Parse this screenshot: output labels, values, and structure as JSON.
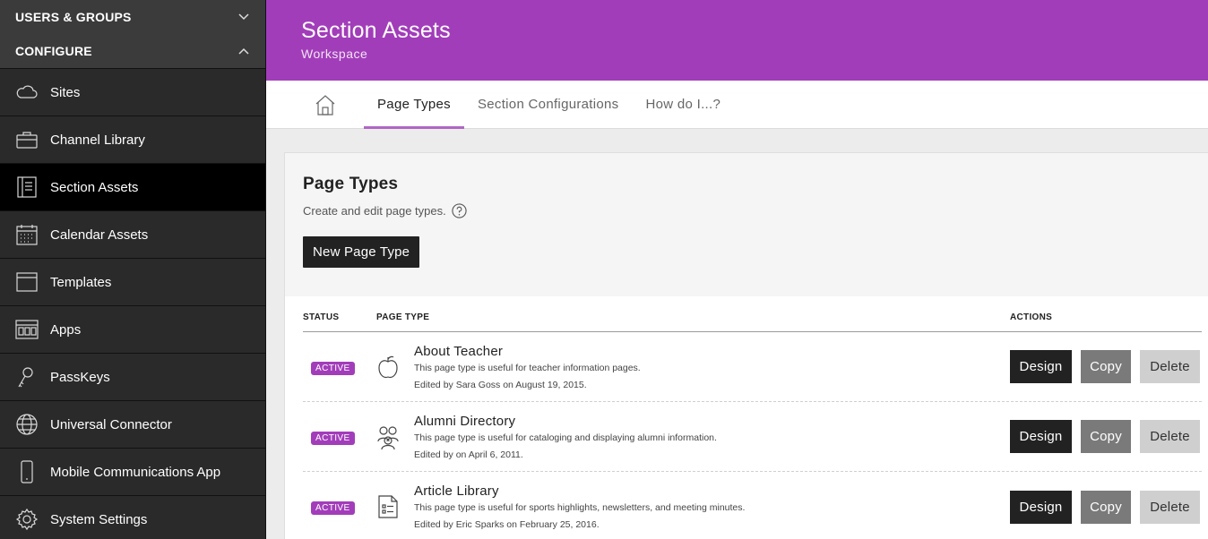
{
  "sidebar": {
    "sections": [
      {
        "label": "USERS & GROUPS",
        "expanded": false
      },
      {
        "label": "CONFIGURE",
        "expanded": true
      }
    ],
    "items": [
      {
        "label": "Sites",
        "icon": "cloud-icon"
      },
      {
        "label": "Channel Library",
        "icon": "briefcase-icon"
      },
      {
        "label": "Section Assets",
        "icon": "section-list-icon",
        "active": true
      },
      {
        "label": "Calendar Assets",
        "icon": "calendar-icon"
      },
      {
        "label": "Templates",
        "icon": "template-icon"
      },
      {
        "label": "Apps",
        "icon": "apps-icon"
      },
      {
        "label": "PassKeys",
        "icon": "passkey-icon"
      },
      {
        "label": "Universal Connector",
        "icon": "globe-icon"
      },
      {
        "label": "Mobile Communications App",
        "icon": "mobile-icon"
      },
      {
        "label": "System Settings",
        "icon": "gear-icon"
      }
    ]
  },
  "header": {
    "title": "Section Assets",
    "subtitle": "Workspace",
    "color": "#a23dba"
  },
  "tabs": [
    {
      "label": "Page Types",
      "active": true
    },
    {
      "label": "Section Configurations",
      "active": false
    },
    {
      "label": "How do I...?",
      "active": false
    }
  ],
  "panel": {
    "title": "Page Types",
    "description": "Create and edit page types.",
    "new_button": "New Page Type"
  },
  "table": {
    "columns": {
      "status": "STATUS",
      "type": "PAGE TYPE",
      "actions": "ACTIONS"
    },
    "rows": [
      {
        "status": "ACTIVE",
        "icon": "apple-icon",
        "name": "About Teacher",
        "description": "This page type is useful for teacher information pages.",
        "edited": "Edited by Sara Goss on August 19, 2015."
      },
      {
        "status": "ACTIVE",
        "icon": "people-icon",
        "name": "Alumni Directory",
        "description": "This page type is useful for cataloging and displaying alumni information.",
        "edited": "Edited by on April 6, 2011."
      },
      {
        "status": "ACTIVE",
        "icon": "document-list-icon",
        "name": "Article Library",
        "description": "This page type is useful for sports highlights, newsletters, and meeting minutes.",
        "edited": "Edited by Eric Sparks on February 25, 2016."
      }
    ],
    "actions": {
      "design": "Design",
      "copy": "Copy",
      "delete": "Delete"
    }
  }
}
